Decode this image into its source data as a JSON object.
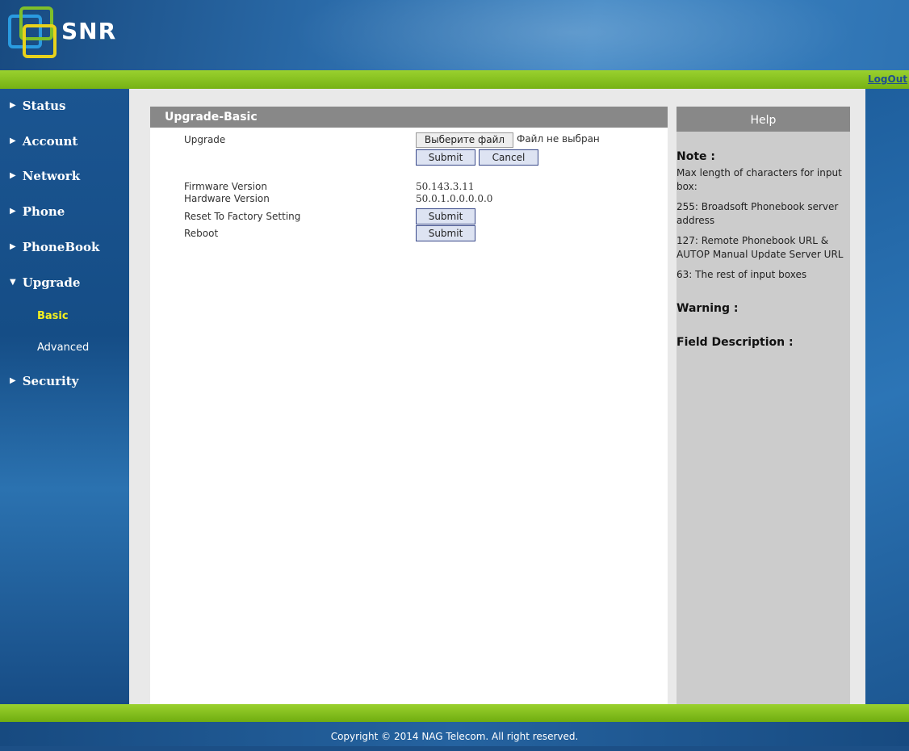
{
  "brand": {
    "logo_text": "SNR"
  },
  "header": {
    "logout_label": "LogOut"
  },
  "sidebar": {
    "items": [
      {
        "label": "Status"
      },
      {
        "label": "Account"
      },
      {
        "label": "Network"
      },
      {
        "label": "Phone"
      },
      {
        "label": "PhoneBook"
      },
      {
        "label": "Upgrade"
      },
      {
        "label": "Security"
      }
    ],
    "subitems": [
      {
        "label": "Basic",
        "active": true
      },
      {
        "label": "Advanced",
        "active": false
      }
    ]
  },
  "main": {
    "title": "Upgrade-Basic",
    "upgrade_label": "Upgrade",
    "choose_file_label": "Выберите файл",
    "no_file_text": "Файл не выбран",
    "submit_label": "Submit",
    "cancel_label": "Cancel",
    "firmware_label": "Firmware Version",
    "firmware_value": "50.143.3.11",
    "hardware_label": "Hardware Version",
    "hardware_value": "50.0.1.0.0.0.0.0",
    "reset_label": "Reset To Factory Setting",
    "reset_button": "Submit",
    "reboot_label": "Reboot",
    "reboot_button": "Submit"
  },
  "help": {
    "title": "Help",
    "note_heading": "Note :",
    "note_lines": [
      "Max length of characters for input box:",
      "255: Broadsoft Phonebook server address",
      "127: Remote Phonebook URL & AUTOP Manual Update Server URL",
      "63: The rest of input boxes"
    ],
    "warning_heading": "Warning :",
    "field_heading": "Field Description :"
  },
  "footer": {
    "copyright": "Copyright © 2014 NAG Telecom. All right reserved."
  },
  "colors": {
    "accent_green": "#8cc620",
    "nav_blue": "#1b5591",
    "active_nav": "#f5f01e",
    "panel_gray": "#888888"
  }
}
